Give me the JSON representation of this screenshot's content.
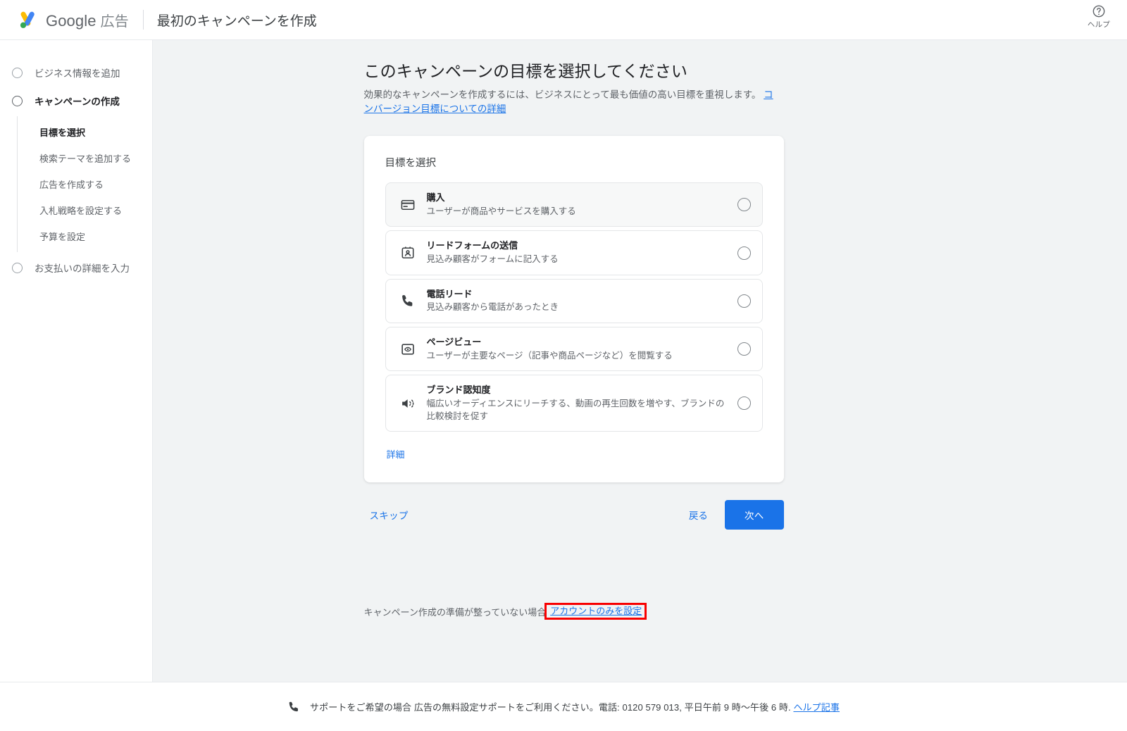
{
  "topbar": {
    "logo_icon": "google-ads-logo",
    "brand_google": "Google",
    "brand_suffix": "広告",
    "page_title": "最初のキャンペーンを作成",
    "help_icon": "help-circle-icon",
    "help_label": "ヘルプ"
  },
  "sidebar": {
    "steps": [
      {
        "label": "ビジネス情報を追加",
        "active": false,
        "substeps": []
      },
      {
        "label": "キャンペーンの作成",
        "active": true,
        "substeps": [
          {
            "label": "目標を選択",
            "current": true
          },
          {
            "label": "検索テーマを追加する",
            "current": false
          },
          {
            "label": "広告を作成する",
            "current": false
          },
          {
            "label": "入札戦略を設定する",
            "current": false
          },
          {
            "label": "予算を設定",
            "current": false
          }
        ]
      },
      {
        "label": "お支払いの詳細を入力",
        "active": false,
        "substeps": []
      }
    ]
  },
  "main": {
    "heading": "このキャンペーンの目標を選択してください",
    "subheading_text": "効果的なキャンペーンを作成するには、ビジネスにとって最も価値の高い目標を重視します。 ",
    "subheading_link": "コンバージョン目標についての詳細",
    "card_title": "目標を選択",
    "goals": [
      {
        "name": "購入",
        "desc": "ユーザーが商品やサービスを購入する",
        "icon": "credit-card-icon",
        "highlighted": true,
        "selected": false
      },
      {
        "name": "リードフォームの送信",
        "desc": "見込み顧客がフォームに記入する",
        "icon": "contact-card-icon",
        "highlighted": false,
        "selected": false
      },
      {
        "name": "電話リード",
        "desc": "見込み顧客から電話があったとき",
        "icon": "phone-icon",
        "highlighted": false,
        "selected": false
      },
      {
        "name": "ページビュー",
        "desc": "ユーザーが主要なページ（記事や商品ページなど）を閲覧する",
        "icon": "page-view-eye-icon",
        "highlighted": false,
        "selected": false
      },
      {
        "name": "ブランド認知度",
        "desc": "幅広いオーディエンスにリーチする、動画の再生回数を増やす、ブランドの比較検討を促す",
        "icon": "megaphone-speaker-icon",
        "highlighted": false,
        "selected": false
      }
    ],
    "details_link": "詳細",
    "skip_label": "スキップ",
    "back_label": "戻る",
    "next_label": "次へ",
    "account_only_prefix": "キャンペーン作成の準備が整っていない場合",
    "account_only_link": "アカウントのみを設定"
  },
  "footer": {
    "phone_icon": "phone-icon",
    "text": "サポートをご希望の場合 広告の無料設定サポートをご利用ください。電話: 0120 579 013, 平日午前 9 時〜午後 6 時.",
    "link": "ヘルプ記事"
  },
  "colors": {
    "accent_blue": "#1a73e8",
    "highlight_red": "#f80000",
    "page_bg": "#f1f3f4",
    "logo_yellow": "#fbbc04",
    "logo_blue": "#4285f4",
    "logo_green": "#34a853"
  }
}
